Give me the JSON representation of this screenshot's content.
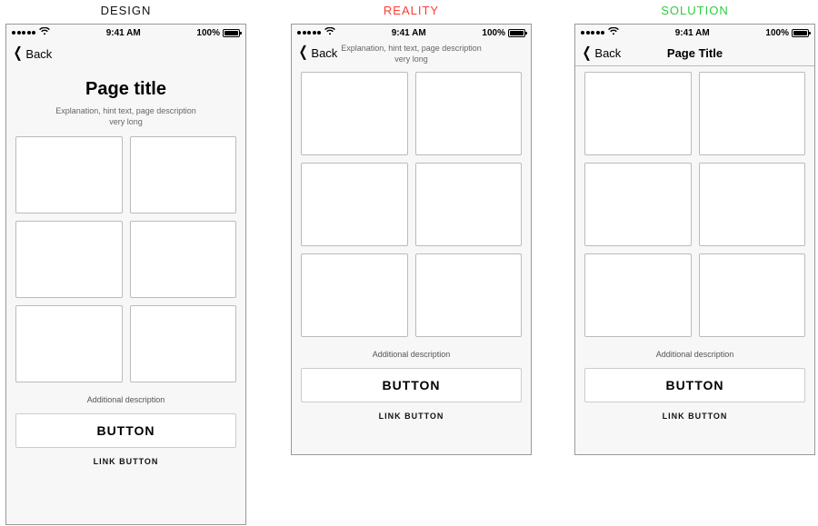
{
  "labels": {
    "design": "DESIGN",
    "reality": "REALITY",
    "solution": "SOLUTION"
  },
  "status": {
    "time": "9:41 AM",
    "battery_pct": "100%"
  },
  "nav": {
    "back": "Back",
    "solution_title": "Page Title"
  },
  "design": {
    "title": "Page title",
    "hint_line1": "Explanation, hint text, page description",
    "hint_line2": "very long",
    "additional": "Additional description",
    "button": "BUTTON",
    "link": "LINK BUTTON"
  },
  "reality": {
    "hint_line1": "Explanation, hint text, page description",
    "hint_line2": "very long",
    "additional": "Additional description",
    "button": "BUTTON",
    "link": "LINK BUTTON"
  },
  "solution": {
    "additional": "Additional description",
    "button": "BUTTON",
    "link": "LINK BUTTON"
  }
}
